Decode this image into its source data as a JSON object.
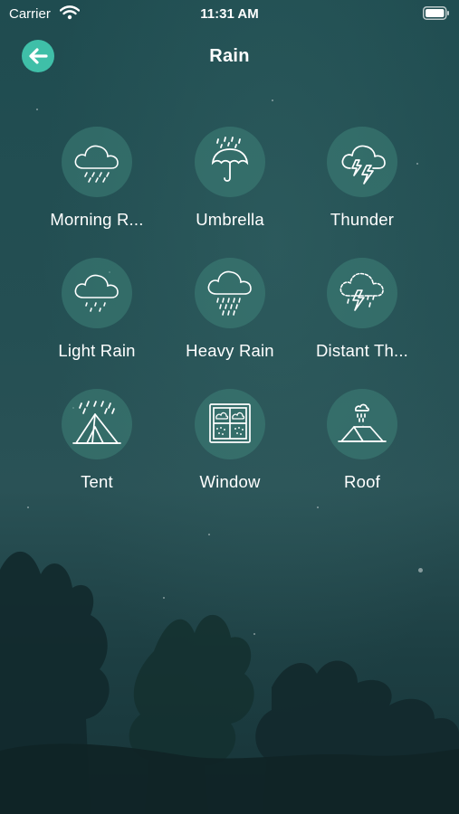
{
  "status_bar": {
    "carrier": "Carrier",
    "time": "11:31 AM"
  },
  "nav": {
    "title": "Rain",
    "back_icon": "arrow-left-icon"
  },
  "colors": {
    "accent": "#3fbfa8",
    "circle": "#2f6e68",
    "background": "#1f4c50"
  },
  "sounds": [
    {
      "label": "Morning R...",
      "icon": "cloud-drizzle-icon"
    },
    {
      "label": "Umbrella",
      "icon": "umbrella-rain-icon"
    },
    {
      "label": "Thunder",
      "icon": "cloud-lightning-icon"
    },
    {
      "label": "Light Rain",
      "icon": "cloud-light-rain-icon"
    },
    {
      "label": "Heavy Rain",
      "icon": "cloud-heavy-rain-icon"
    },
    {
      "label": "Distant Th...",
      "icon": "cloud-distant-thunder-icon"
    },
    {
      "label": "Tent",
      "icon": "tent-rain-icon"
    },
    {
      "label": "Window",
      "icon": "window-rain-icon"
    },
    {
      "label": "Roof",
      "icon": "roof-rain-icon"
    }
  ]
}
